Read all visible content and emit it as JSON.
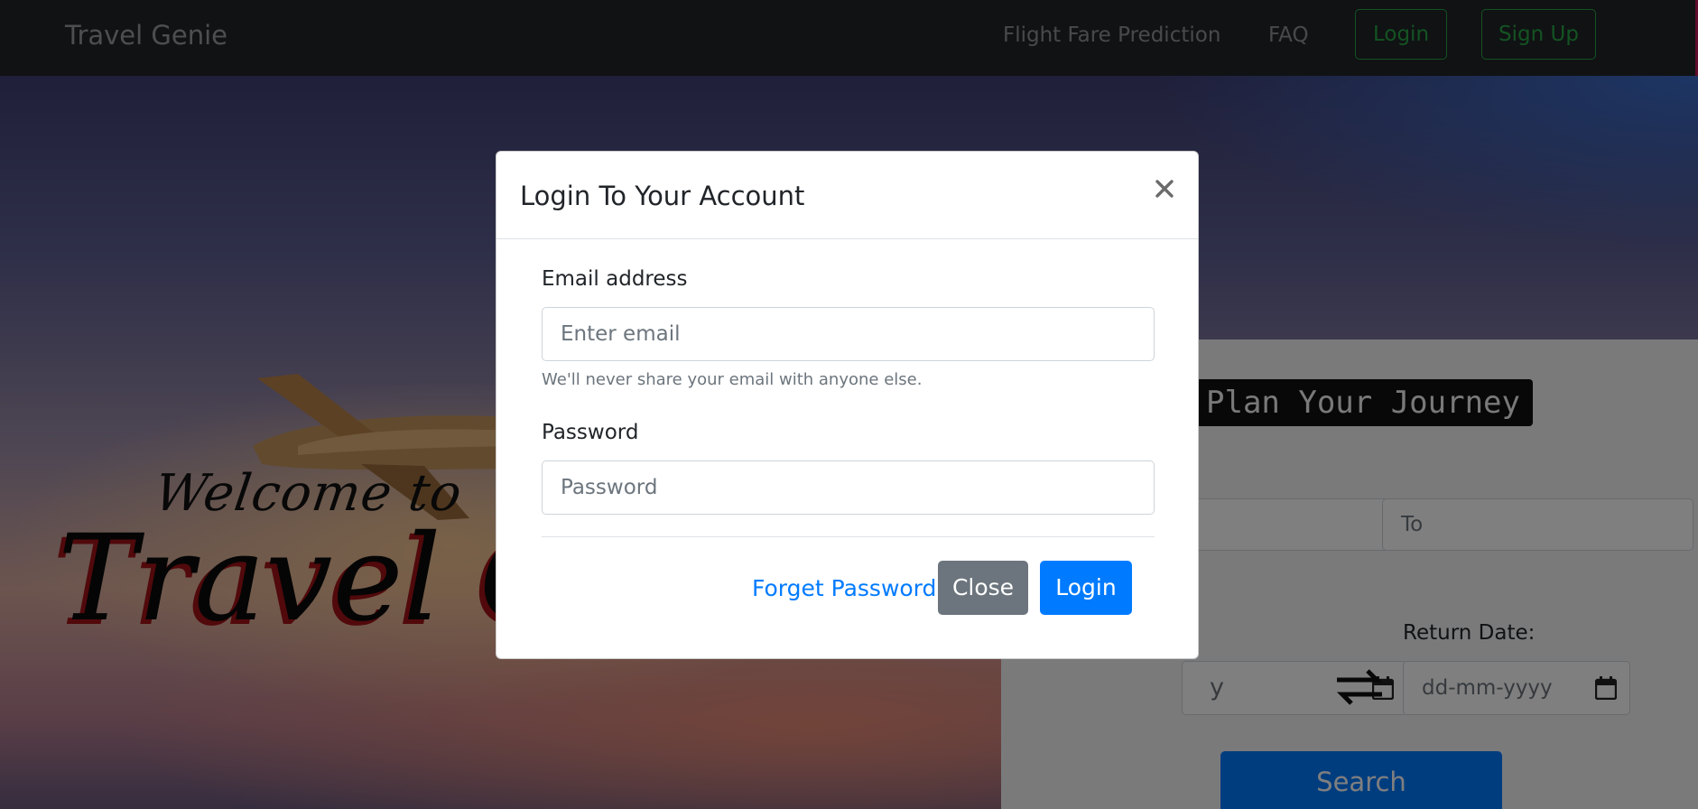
{
  "navbar": {
    "brand": "Travel Genie",
    "links": [
      "Flight Fare Prediction",
      "FAQ"
    ],
    "login_label": "Login",
    "signup_label": "Sign Up"
  },
  "hero": {
    "welcome_small": "Welcome to",
    "welcome_big": "Travel Genie"
  },
  "journey": {
    "title": "Plan Your Journey",
    "to_placeholder": "To",
    "return_label": "Return Date:",
    "depart_value": "y",
    "return_placeholder": "dd-mm-yyyy",
    "search_label": "Search"
  },
  "modal": {
    "title": "Login To Your Account",
    "close_symbol": "×",
    "email_label": "Email address",
    "email_placeholder": "Enter email",
    "email_help": "We'll never share your email with anyone else.",
    "password_label": "Password",
    "password_placeholder": "Password",
    "forgot_label": "Forget Password?",
    "close_label": "Close",
    "login_label": "Login"
  },
  "colors": {
    "navbar_bg": "#212529",
    "success": "#28a745",
    "primary": "#007bff",
    "secondary": "#6c757d"
  },
  "icons": [
    "close-icon",
    "calendar-icon",
    "swap-icon",
    "airplane-icon"
  ]
}
